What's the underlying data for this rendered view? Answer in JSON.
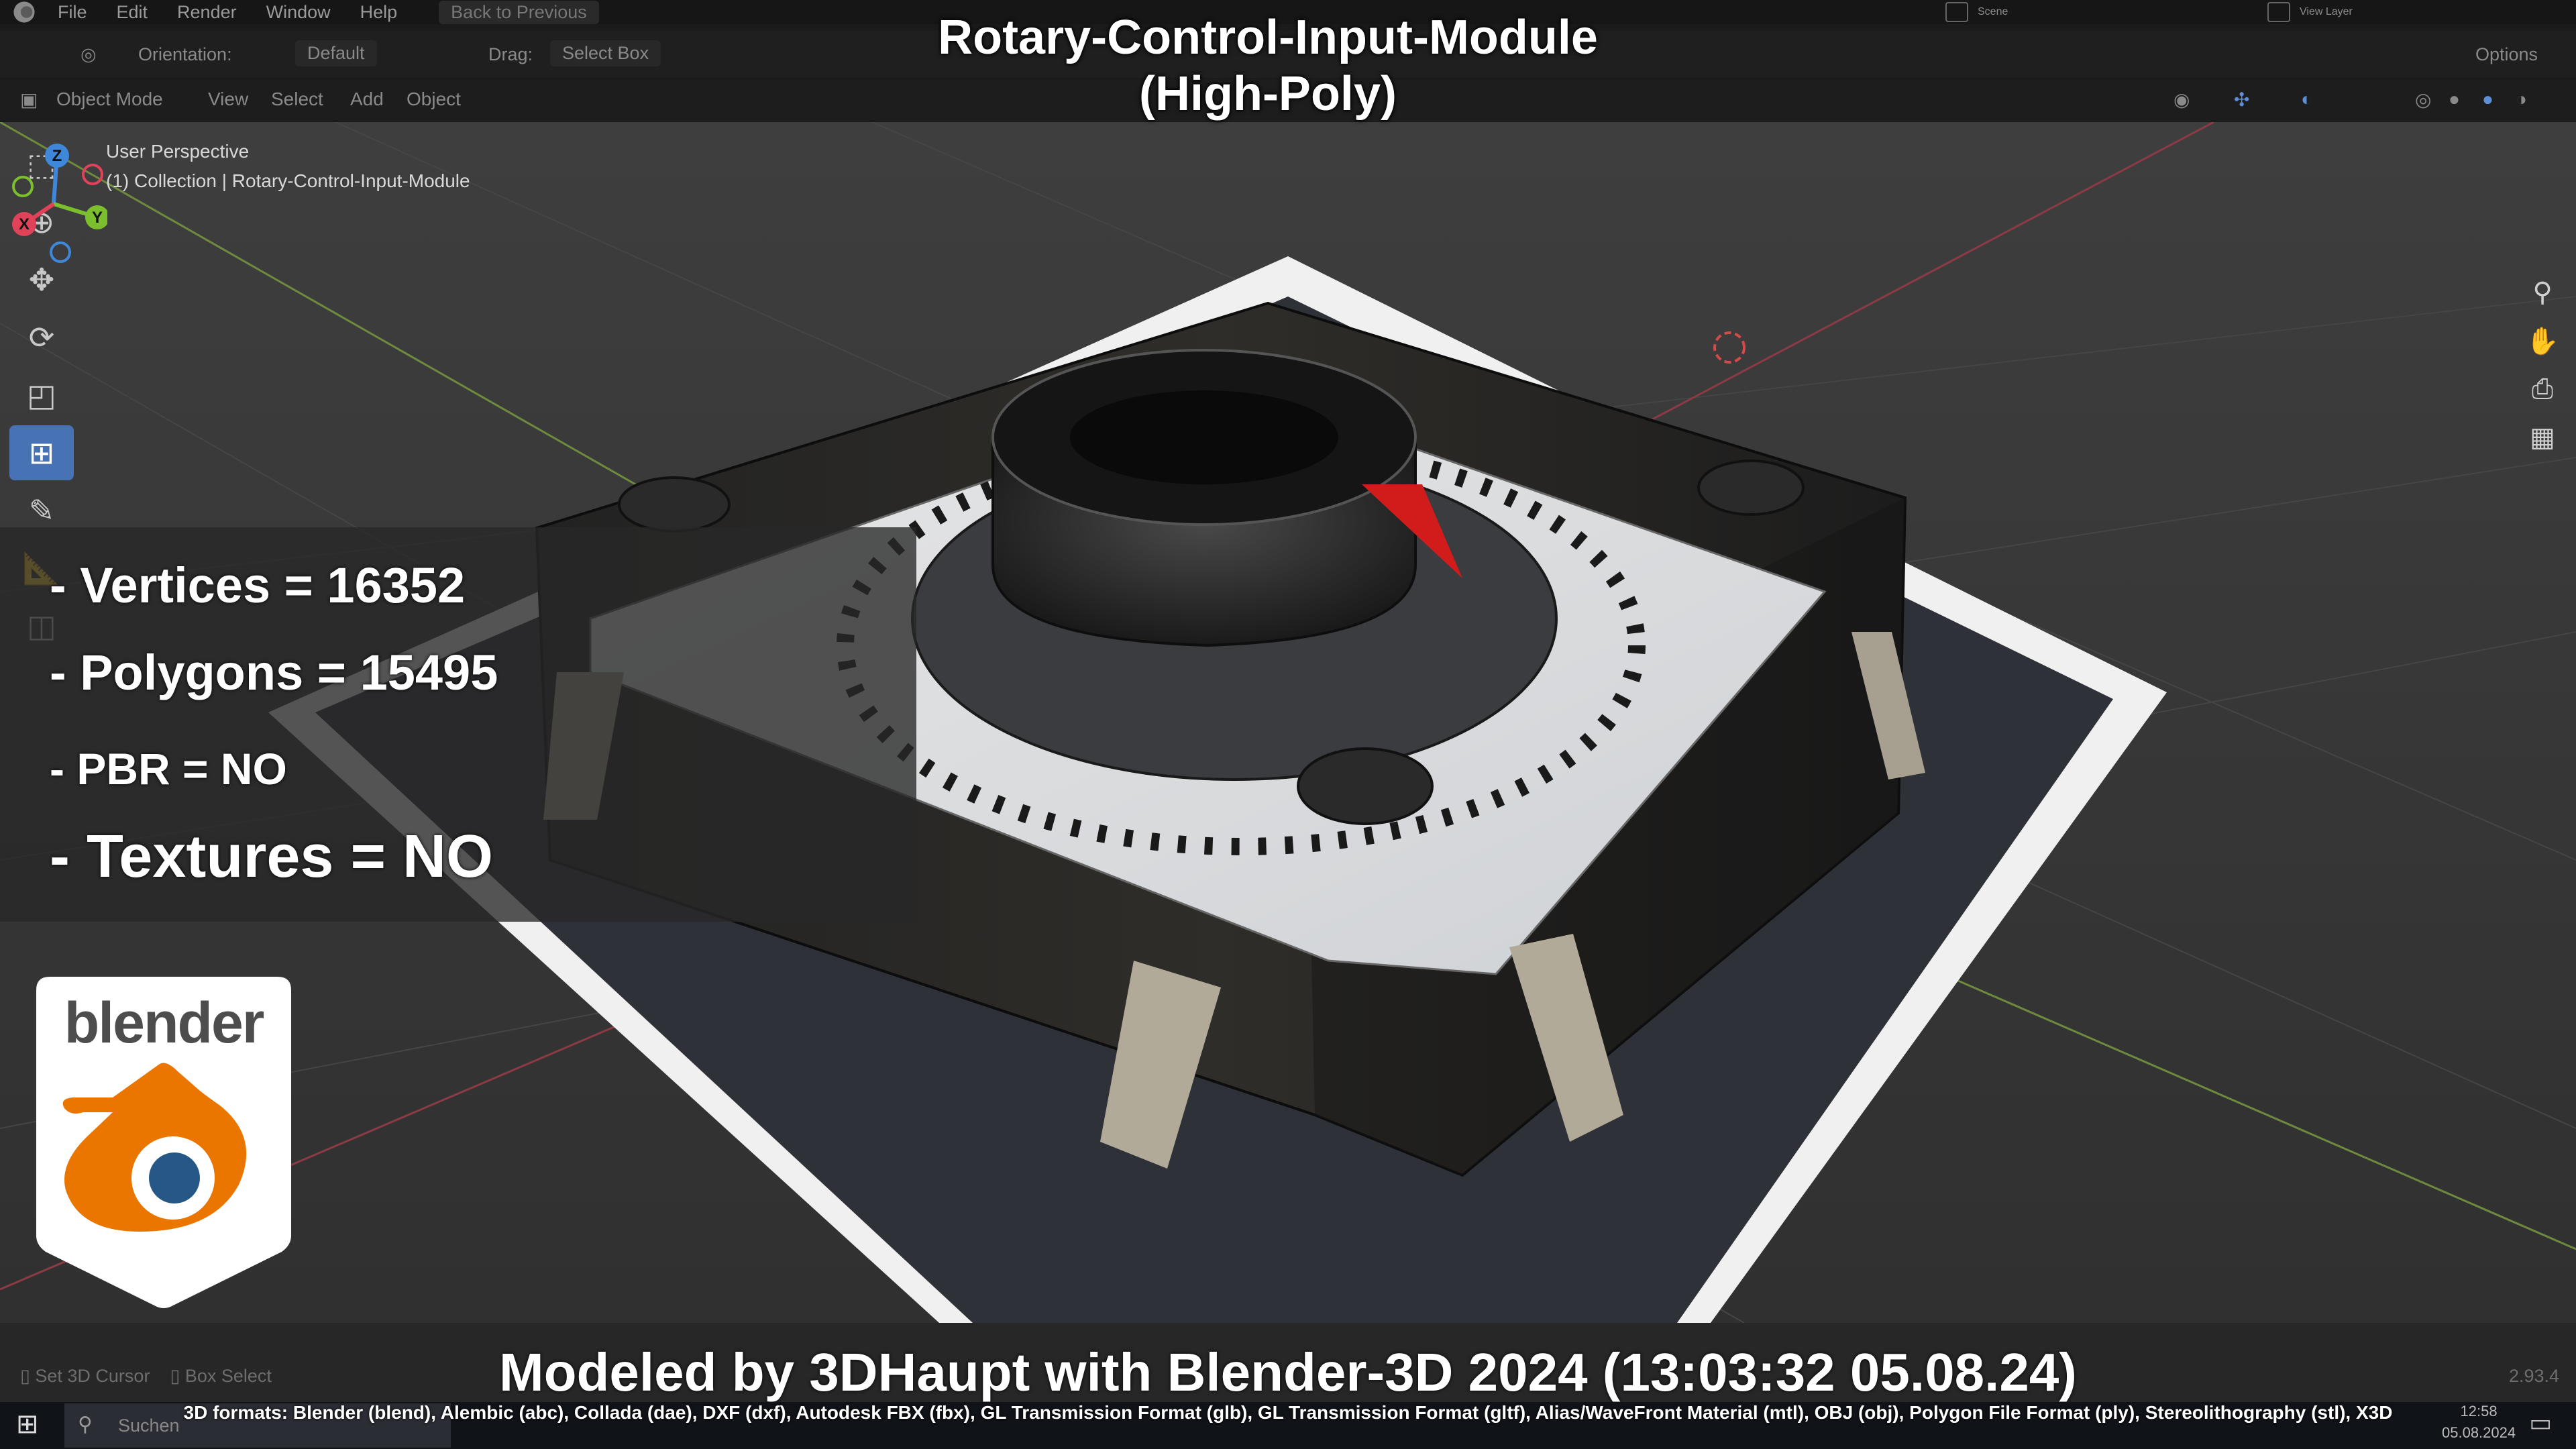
{
  "topbar": {
    "menus": [
      "File",
      "Edit",
      "Render",
      "Window",
      "Help"
    ],
    "back_button": "Back to Previous",
    "scene": "Scene",
    "view_layer": "View Layer"
  },
  "tool_settings": {
    "orientation_label": "Orientation:",
    "orientation_value": "Default",
    "drag_label": "Drag:",
    "drag_value": "Select Box",
    "options": "Options"
  },
  "header": {
    "mode": "Object Mode",
    "menus": [
      "View",
      "Select",
      "Add",
      "Object"
    ]
  },
  "viewport": {
    "perspective": "User Perspective",
    "collection": "(1) Collection | Rotary-Control-Input-Module"
  },
  "overlay": {
    "title_line1": "Rotary-Control-Input-Module",
    "title_line2": "(High-Poly)",
    "stats": {
      "vertices": "- Vertices = 16352",
      "polygons": "- Polygons = 15495",
      "pbr": "- PBR =  NO",
      "textures": "- Textures = NO"
    },
    "badge_word": "blender",
    "credit": "Modeled by 3DHaupt with Blender-3D 2024 (13:03:32  05.08.24)",
    "formats": "3D formats: Blender (blend), Alembic (abc), Collada (dae), DXF (dxf), Autodesk FBX (fbx), GL Transmission Format (glb), GL Transmission Format (gltf), Alias/WaveFront Material (mtl), OBJ (obj), Polygon File Format (ply), Stereolithography (stl), X3D"
  },
  "statusbar": {
    "left_1": "Set 3D Cursor",
    "left_2": "Box Select",
    "version": "2.93.4"
  },
  "taskbar": {
    "search": "Suchen",
    "time": "12:58",
    "date": "05.08.2024"
  },
  "gizmo": {
    "x": "X",
    "y": "Y",
    "z": "Z"
  },
  "colors": {
    "accent": "#4772b3",
    "x_axis": "#e0425a",
    "y_axis": "#7cbf2e",
    "z_axis": "#3f87d8",
    "badge_orange": "#ea7600",
    "badge_blue": "#265787"
  }
}
